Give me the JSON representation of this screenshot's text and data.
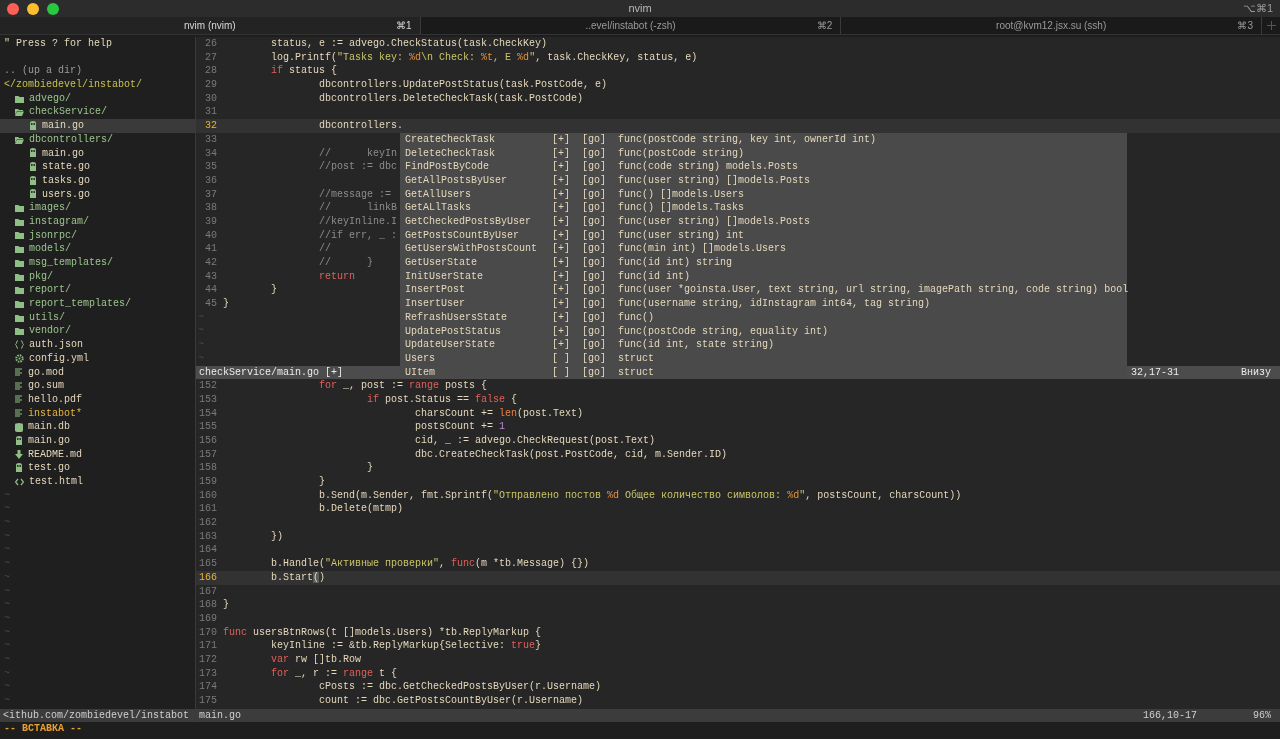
{
  "window": {
    "title": "nvim",
    "shortcut": "⌥⌘1"
  },
  "tabs": [
    {
      "label": "nvim (nvim)",
      "shortcut": "⌘1",
      "selected": true
    },
    {
      "label": "..evel/instabot (-zsh)",
      "shortcut": "⌘2",
      "selected": false
    },
    {
      "label": "root@kvm12.jsx.su (ssh)",
      "shortcut": "⌘3",
      "selected": false
    }
  ],
  "sidebar": {
    "help": "\" Press ? for help",
    "up": ".. (up a dir)",
    "root": "</zombiedevel/instabot/",
    "items": [
      {
        "kind": "folder",
        "name": "advego/",
        "expanded": false,
        "selected": false
      },
      {
        "kind": "folder",
        "name": "checkService/",
        "expanded": true,
        "selected": false,
        "children": [
          {
            "kind": "go",
            "name": "main.go",
            "selected": true
          }
        ]
      },
      {
        "kind": "folder",
        "name": "dbcontrollers/",
        "expanded": true,
        "selected": false,
        "children": [
          {
            "kind": "go",
            "name": "main.go",
            "selected": false
          },
          {
            "kind": "go",
            "name": "state.go",
            "selected": false
          },
          {
            "kind": "go",
            "name": "tasks.go",
            "selected": false
          },
          {
            "kind": "go",
            "name": "users.go",
            "selected": false
          }
        ]
      },
      {
        "kind": "folder",
        "name": "images/",
        "expanded": false,
        "selected": false
      },
      {
        "kind": "folder",
        "name": "instagram/",
        "expanded": false,
        "selected": false
      },
      {
        "kind": "folder",
        "name": "jsonrpc/",
        "expanded": false,
        "selected": false
      },
      {
        "kind": "folder",
        "name": "models/",
        "expanded": false,
        "selected": false
      },
      {
        "kind": "folder",
        "name": "msg_templates/",
        "expanded": false,
        "selected": false
      },
      {
        "kind": "folder",
        "name": "pkg/",
        "expanded": false,
        "selected": false
      },
      {
        "kind": "folder",
        "name": "report/",
        "expanded": false,
        "selected": false
      },
      {
        "kind": "folder",
        "name": "report_templates/",
        "expanded": false,
        "selected": false
      },
      {
        "kind": "folder",
        "name": "utils/",
        "expanded": false,
        "selected": false
      },
      {
        "kind": "folder",
        "name": "vendor/",
        "expanded": false,
        "selected": false
      },
      {
        "kind": "json",
        "name": "auth.json",
        "selected": false
      },
      {
        "kind": "config",
        "name": "config.yml",
        "selected": false
      },
      {
        "kind": "text",
        "name": "go.mod",
        "selected": false
      },
      {
        "kind": "text",
        "name": "go.sum",
        "selected": false
      },
      {
        "kind": "text",
        "name": "hello.pdf",
        "selected": false
      },
      {
        "kind": "text",
        "name": "instabot*",
        "executable": true,
        "selected": false
      },
      {
        "kind": "db",
        "name": "main.db",
        "selected": false
      },
      {
        "kind": "go",
        "name": "main.go",
        "selected": false
      },
      {
        "kind": "markdown",
        "name": "README.md",
        "selected": false
      },
      {
        "kind": "go",
        "name": "test.go",
        "selected": false
      },
      {
        "kind": "html",
        "name": "test.html",
        "selected": false
      }
    ],
    "filler": [
      "~",
      "~",
      "~",
      "~",
      "~",
      "~",
      "~",
      "~",
      "~",
      "~",
      "~",
      "~",
      "~",
      "~",
      "~",
      "~"
    ],
    "status": "<ithub.com/zombiedevel/instabot"
  },
  "top_pane": {
    "lines": [
      {
        "number": "26",
        "cursorline": false,
        "tokens": [
          {
            "kind": "plain",
            "text": "\tstatus, e := advego.CheckStatus(task.CheckKey)"
          }
        ]
      },
      {
        "number": "27",
        "cursorline": false,
        "tokens": [
          {
            "kind": "plain",
            "text": "\tlog.Printf("
          },
          {
            "kind": "string",
            "text": "\"Tasks key: "
          },
          {
            "kind": "format",
            "text": "%d"
          },
          {
            "kind": "string",
            "text": "\\n Check: "
          },
          {
            "kind": "format",
            "text": "%t"
          },
          {
            "kind": "string",
            "text": ", E "
          },
          {
            "kind": "format",
            "text": "%d"
          },
          {
            "kind": "string",
            "text": "\""
          },
          {
            "kind": "plain",
            "text": ", task.CheckKey, status, e)"
          }
        ]
      },
      {
        "number": "28",
        "cursorline": false,
        "tokens": [
          {
            "kind": "keyword",
            "text": "\tif"
          },
          {
            "kind": "plain",
            "text": " status {"
          }
        ]
      },
      {
        "number": "29",
        "cursorline": false,
        "tokens": [
          {
            "kind": "plain",
            "text": "\t\tdbcontrollers.UpdatePostStatus(task.PostCode, e)"
          }
        ]
      },
      {
        "number": "30",
        "cursorline": false,
        "tokens": [
          {
            "kind": "plain",
            "text": "\t\tdbcontrollers.DeleteCheckTask(task.PostCode)"
          }
        ]
      },
      {
        "number": "31",
        "cursorline": false
      },
      {
        "number": "32",
        "cursorline": true,
        "tokens": [
          {
            "kind": "plain",
            "text": "\t\tdbcontrollers."
          }
        ]
      },
      {
        "number": "33",
        "cursorline": false
      },
      {
        "number": "34",
        "cursorline": false,
        "tokens": [
          {
            "kind": "comment",
            "text": "\t\t//\tkeyIn"
          }
        ]
      },
      {
        "number": "35",
        "cursorline": false,
        "tokens": [
          {
            "kind": "comment",
            "text": "\t\t//post := dbc"
          }
        ]
      },
      {
        "number": "36",
        "cursorline": false
      },
      {
        "number": "37",
        "cursorline": false,
        "tokens": [
          {
            "kind": "comment",
            "text": "\t\t//message :="
          }
        ]
      },
      {
        "number": "38",
        "cursorline": false,
        "tokens": [
          {
            "kind": "comment",
            "text": "\t\t//\tlinkB"
          }
        ]
      },
      {
        "number": "39",
        "cursorline": false,
        "tokens": [
          {
            "kind": "comment",
            "text": "\t\t//keyInline.I"
          }
        ]
      },
      {
        "number": "40",
        "cursorline": false,
        "tokens": [
          {
            "kind": "comment",
            "text": "\t\t//if err, _ :"
          }
        ]
      },
      {
        "number": "41",
        "cursorline": false,
        "tokens": [
          {
            "kind": "comment",
            "text": "\t\t//"
          }
        ]
      },
      {
        "number": "42",
        "cursorline": false,
        "tokens": [
          {
            "kind": "comment",
            "text": "\t\t//\t}"
          }
        ]
      },
      {
        "number": "43",
        "cursorline": false,
        "tokens": [
          {
            "kind": "keyword",
            "text": "\t\treturn"
          }
        ]
      },
      {
        "number": "44",
        "cursorline": false,
        "tokens": [
          {
            "kind": "plain",
            "text": "\t}"
          }
        ]
      },
      {
        "number": "45",
        "cursorline": false,
        "tokens": [
          {
            "kind": "plain",
            "text": "}"
          }
        ]
      }
    ],
    "filler": [
      "~",
      "~",
      "~",
      "~"
    ],
    "status": {
      "file": "checkService/main.go [+]",
      "position": "32,17-31",
      "scroll": "Внизу"
    },
    "completion": [
      {
        "name": "CreateCheckTask",
        "flag": "[+]",
        "source": "[go]",
        "signature": "func(postCode string, key int, ownerId int)"
      },
      {
        "name": "DeleteCheckTask",
        "flag": "[+]",
        "source": "[go]",
        "signature": "func(postCode string)"
      },
      {
        "name": "FindPostByCode",
        "flag": "[+]",
        "source": "[go]",
        "signature": "func(code string) models.Posts"
      },
      {
        "name": "GetAllPostsByUser",
        "flag": "[+]",
        "source": "[go]",
        "signature": "func(user string) []models.Posts"
      },
      {
        "name": "GetAllUsers",
        "flag": "[+]",
        "source": "[go]",
        "signature": "func() []models.Users"
      },
      {
        "name": "GetALlTasks",
        "flag": "[+]",
        "source": "[go]",
        "signature": "func() []models.Tasks"
      },
      {
        "name": "GetCheckedPostsByUser",
        "flag": "[+]",
        "source": "[go]",
        "signature": "func(user string) []models.Posts"
      },
      {
        "name": "GetPostsCountByUser",
        "flag": "[+]",
        "source": "[go]",
        "signature": "func(user string) int"
      },
      {
        "name": "GetUsersWithPostsCount",
        "flag": "[+]",
        "source": "[go]",
        "signature": "func(min int) []models.Users"
      },
      {
        "name": "GetUserState",
        "flag": "[+]",
        "source": "[go]",
        "signature": "func(id int) string"
      },
      {
        "name": "InitUserState",
        "flag": "[+]",
        "source": "[go]",
        "signature": "func(id int)"
      },
      {
        "name": "InsertPost",
        "flag": "[+]",
        "source": "[go]",
        "signature": "func(user *goinsta.User, text string, url string, imagePath string, code string) bool"
      },
      {
        "name": "InsertUser",
        "flag": "[+]",
        "source": "[go]",
        "signature": "func(username string, idInstagram int64, tag string)"
      },
      {
        "name": "RefrashUsersState",
        "flag": "[+]",
        "source": "[go]",
        "signature": "func()"
      },
      {
        "name": "UpdatePostStatus",
        "flag": "[+]",
        "source": "[go]",
        "signature": "func(postCode string, equality int)"
      },
      {
        "name": "UpdateUserState",
        "flag": "[+]",
        "source": "[go]",
        "signature": "func(id int, state string)"
      },
      {
        "name": "Users",
        "flag": "[ ]",
        "source": "[go]",
        "signature": "struct"
      },
      {
        "name": "UItem",
        "flag": "[ ]",
        "source": "[go]",
        "signature": "struct"
      }
    ]
  },
  "bottom_pane": {
    "lines": [
      {
        "number": "152",
        "cursorline": false,
        "tokens": [
          {
            "kind": "keyword",
            "text": "\t\tfor"
          },
          {
            "kind": "plain",
            "text": " _, post := "
          },
          {
            "kind": "keyword",
            "text": "range"
          },
          {
            "kind": "plain",
            "text": " posts {"
          }
        ]
      },
      {
        "number": "153",
        "cursorline": false,
        "tokens": [
          {
            "kind": "keyword",
            "text": "\t\t\tif"
          },
          {
            "kind": "plain",
            "text": " post.Status == "
          },
          {
            "kind": "keyword",
            "text": "false"
          },
          {
            "kind": "plain",
            "text": " {"
          }
        ]
      },
      {
        "number": "154",
        "cursorline": false,
        "tokens": [
          {
            "kind": "plain",
            "text": "\t\t\t\tcharsCount += "
          },
          {
            "kind": "builtin",
            "text": "len"
          },
          {
            "kind": "plain",
            "text": "(post.Text)"
          }
        ]
      },
      {
        "number": "155",
        "cursorline": false,
        "tokens": [
          {
            "kind": "plain",
            "text": "\t\t\t\tpostsCount += "
          },
          {
            "kind": "number",
            "text": "1"
          }
        ]
      },
      {
        "number": "156",
        "cursorline": false,
        "tokens": [
          {
            "kind": "plain",
            "text": "\t\t\t\tcid, _ := advego.CheckRequest(post.Text)"
          }
        ]
      },
      {
        "number": "157",
        "cursorline": false,
        "tokens": [
          {
            "kind": "plain",
            "text": "\t\t\t\tdbc.CreateCheckTask(post.PostCode, cid, m.Sender.ID)"
          }
        ]
      },
      {
        "number": "158",
        "cursorline": false,
        "tokens": [
          {
            "kind": "plain",
            "text": "\t\t\t}"
          }
        ]
      },
      {
        "number": "159",
        "cursorline": false,
        "tokens": [
          {
            "kind": "plain",
            "text": "\t\t}"
          }
        ]
      },
      {
        "number": "160",
        "cursorline": false,
        "tokens": [
          {
            "kind": "plain",
            "text": "\t\tb.Send(m.Sender, fmt.Sprintf("
          },
          {
            "kind": "string",
            "text": "\"Отправлено постов "
          },
          {
            "kind": "format",
            "text": "%d"
          },
          {
            "kind": "string",
            "text": " Общее количество символов: "
          },
          {
            "kind": "format",
            "text": "%d"
          },
          {
            "kind": "string",
            "text": "\""
          },
          {
            "kind": "plain",
            "text": ", postsCount, charsCount))"
          }
        ]
      },
      {
        "number": "161",
        "cursorline": false,
        "tokens": [
          {
            "kind": "plain",
            "text": "\t\tb.Delete(mtmp)"
          }
        ]
      },
      {
        "number": "162",
        "cursorline": false
      },
      {
        "number": "163",
        "cursorline": false,
        "tokens": [
          {
            "kind": "plain",
            "text": "\t})"
          }
        ]
      },
      {
        "number": "164",
        "cursorline": false
      },
      {
        "number": "165",
        "cursorline": false,
        "tokens": [
          {
            "kind": "plain",
            "text": "\tb.Handle("
          },
          {
            "kind": "string",
            "text": "\"Активные проверки\""
          },
          {
            "kind": "plain",
            "text": ", "
          },
          {
            "kind": "keyword",
            "text": "func"
          },
          {
            "kind": "plain",
            "text": "(m *tb.Message) {})"
          }
        ]
      },
      {
        "number": "166",
        "cursorline": true,
        "tokens": [
          {
            "kind": "plain",
            "text": "\tb.Start"
          },
          {
            "kind": "match",
            "text": "("
          },
          {
            "kind": "plain",
            "text": ")"
          }
        ]
      },
      {
        "number": "167",
        "cursorline": false
      },
      {
        "number": "168",
        "cursorline": false,
        "tokens": [
          {
            "kind": "plain",
            "text": "}"
          }
        ]
      },
      {
        "number": "169",
        "cursorline": false
      },
      {
        "number": "170",
        "cursorline": false,
        "tokens": [
          {
            "kind": "keyword",
            "text": "func"
          },
          {
            "kind": "plain",
            "text": " usersBtnRows(t []models.Users) *tb.ReplyMarkup {"
          }
        ]
      },
      {
        "number": "171",
        "cursorline": false,
        "tokens": [
          {
            "kind": "plain",
            "text": "\tkeyInline := &tb.ReplyMarkup{Selective: "
          },
          {
            "kind": "keyword",
            "text": "true"
          },
          {
            "kind": "plain",
            "text": "}"
          }
        ]
      },
      {
        "number": "172",
        "cursorline": false,
        "tokens": [
          {
            "kind": "keyword",
            "text": "\tvar"
          },
          {
            "kind": "plain",
            "text": " rw []tb.Row"
          }
        ]
      },
      {
        "number": "173",
        "cursorline": false,
        "tokens": [
          {
            "kind": "keyword",
            "text": "\tfor"
          },
          {
            "kind": "plain",
            "text": " _, r := "
          },
          {
            "kind": "keyword",
            "text": "range"
          },
          {
            "kind": "plain",
            "text": " t {"
          }
        ]
      },
      {
        "number": "174",
        "cursorline": false,
        "tokens": [
          {
            "kind": "plain",
            "text": "\t\tcPosts := dbc.GetCheckedPostsByUser(r.Username)"
          }
        ]
      },
      {
        "number": "175",
        "cursorline": false,
        "tokens": [
          {
            "kind": "plain",
            "text": "\t\tcount := dbc.GetPostsCountByUser(r.Username)"
          }
        ]
      }
    ],
    "status": {
      "file": "main.go",
      "position": "166,10-17",
      "scroll": "96%"
    }
  },
  "mode_line": "-- ВСТАВКА --"
}
